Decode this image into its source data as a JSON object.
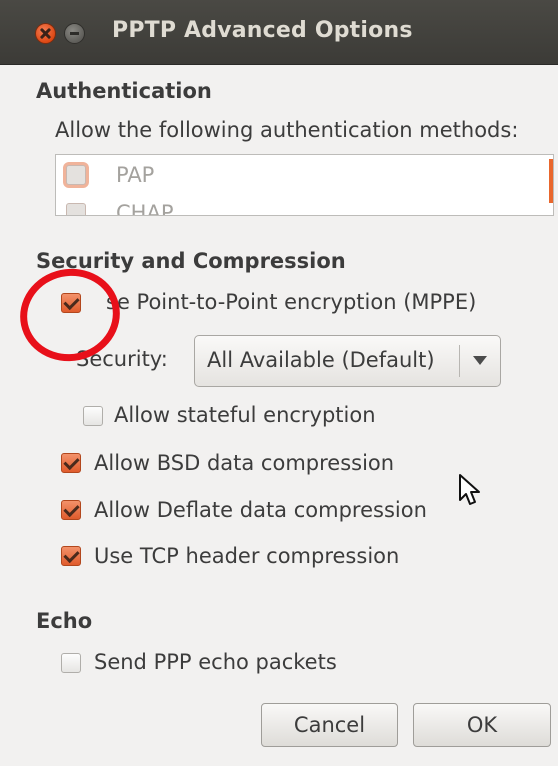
{
  "window": {
    "title": "PPTP Advanced Options"
  },
  "authentication": {
    "heading": "Authentication",
    "methods_label": "Allow the following authentication methods:",
    "methods": [
      {
        "label": "PAP",
        "checked": false
      },
      {
        "label": "CHAP",
        "checked": false
      }
    ]
  },
  "security": {
    "heading": "Security and Compression",
    "use_mppe_label": "Use Point-to-Point encryption (MPPE)",
    "use_mppe_visible_label": "se Point-to-Point encryption (MPPE)",
    "use_mppe_checked": true,
    "security_label": "Security:",
    "security_value": "All Available (Default)",
    "stateful_label": "Allow stateful encryption",
    "stateful_checked": false,
    "bsd_label": "Allow BSD data compression",
    "bsd_checked": true,
    "deflate_label": "Allow Deflate data compression",
    "deflate_checked": true,
    "tcp_label": "Use TCP header compression",
    "tcp_checked": true
  },
  "echo": {
    "heading": "Echo",
    "send_label": "Send PPP echo packets",
    "send_checked": false
  },
  "buttons": {
    "cancel": "Cancel",
    "ok": "OK"
  },
  "colors": {
    "accent": "#e05b2c",
    "annotation": "#e8101a",
    "titlebar": "#3c3b37"
  }
}
